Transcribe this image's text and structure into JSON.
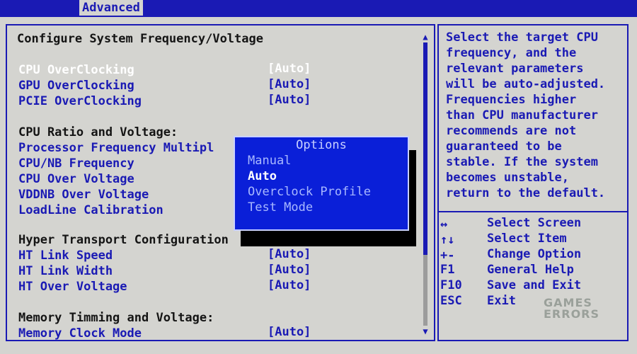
{
  "tab": {
    "label": "Advanced"
  },
  "main": {
    "title": "Configure System Frequency/Voltage",
    "rows_top": [
      {
        "label": "CPU OverClocking",
        "value": "[Auto]"
      },
      {
        "label": "GPU OverClocking",
        "value": "[Auto]"
      },
      {
        "label": "PCIE OverClocking",
        "value": "[Auto]"
      }
    ],
    "cpu_section": "CPU Ratio and Voltage:",
    "cpu_items": [
      "Processor Frequency Multipl",
      "CPU/NB Frequency",
      "CPU Over Voltage",
      "VDDNB Over Voltage",
      "LoadLine Calibration"
    ],
    "ht_section": "Hyper Transport Configuration",
    "ht_rows": [
      {
        "label": "HT Link Speed",
        "value": "[Auto]"
      },
      {
        "label": "HT Link Width",
        "value": "[Auto]"
      },
      {
        "label": "HT Over Voltage",
        "value": "[Auto]"
      }
    ],
    "mem_section": "Memory Timming and Voltage:",
    "mem_rows": [
      {
        "label": "Memory Clock Mode",
        "value": "[Auto]"
      }
    ]
  },
  "popup": {
    "title": "Options",
    "options": [
      "Manual",
      "Auto",
      "Overclock Profile",
      "Test Mode"
    ],
    "selected": "Auto"
  },
  "help": {
    "lines": [
      "Select the target CPU",
      "frequency, and the",
      "relevant parameters",
      "will be auto-adjusted.",
      "Frequencies higher",
      "than CPU manufacturer",
      "recommends are not",
      "guaranteed to be",
      "stable. If the system",
      "becomes unstable,",
      "return to the default."
    ],
    "keys": [
      {
        "key": "↔",
        "desc": "Select Screen"
      },
      {
        "key": "↑↓",
        "desc": "Select Item"
      },
      {
        "key": "+-",
        "desc": "Change Option"
      },
      {
        "key": "F1",
        "desc": "General Help"
      },
      {
        "key": "F10",
        "desc": "Save and Exit"
      },
      {
        "key": "ESC",
        "desc": "Exit"
      }
    ]
  },
  "watermark": {
    "line1": "GAMES",
    "line2": "ERRORS"
  },
  "colors": {
    "bios_gray": "#d4d4d0",
    "bios_blue": "#1a1ab4",
    "popup_blue": "#0a1fd8"
  }
}
